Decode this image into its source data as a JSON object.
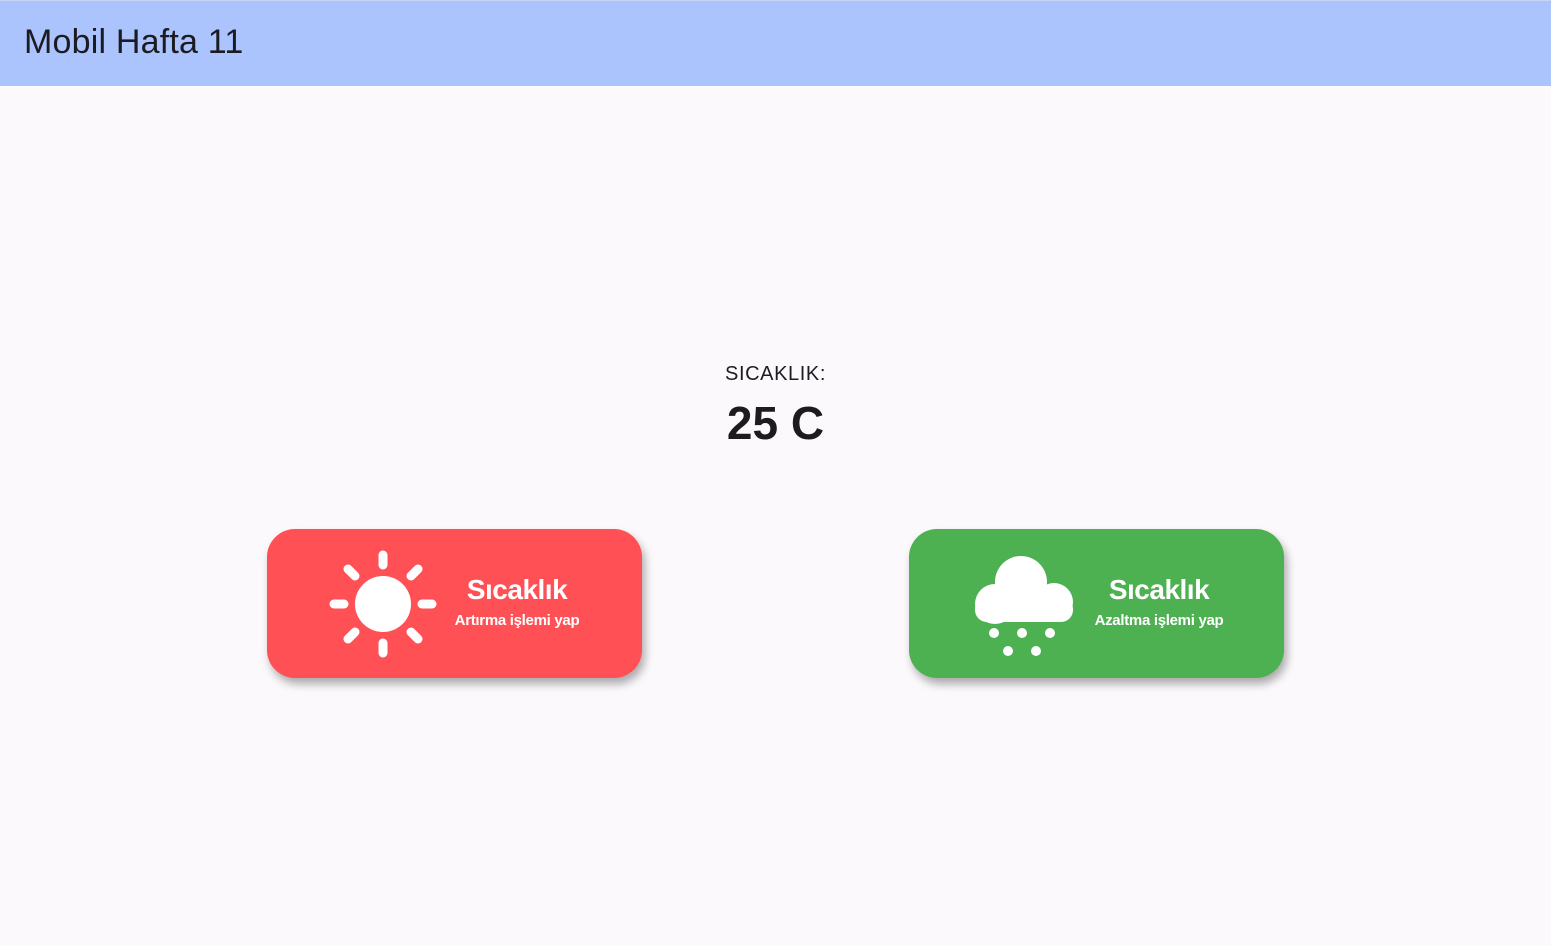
{
  "appbar": {
    "title": "Mobil Hafta 11",
    "color": "#abc4fe"
  },
  "temperature": {
    "label": "SICAKLIK:",
    "value": "25 C"
  },
  "buttons": {
    "increase": {
      "title": "Sıcaklık",
      "subtitle": "Artırma işlemi yap",
      "icon": "sun-icon",
      "color": "#ff5155"
    },
    "decrease": {
      "title": "Sıcaklık",
      "subtitle": "Azaltma işlemi yap",
      "icon": "cloud-snow-icon",
      "color": "#4db051"
    }
  }
}
